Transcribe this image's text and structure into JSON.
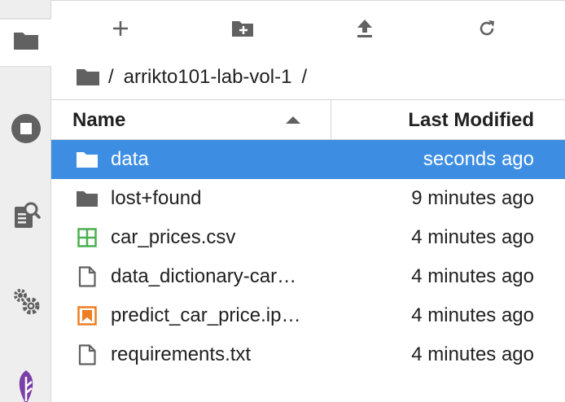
{
  "activity_bar": {
    "items": [
      {
        "name": "file-browser",
        "icon": "folder-icon",
        "active": true
      },
      {
        "name": "running",
        "icon": "stop-circle-icon",
        "active": false
      },
      {
        "name": "property-inspector",
        "icon": "inspector-icon",
        "active": false
      },
      {
        "name": "extensions",
        "icon": "gears-icon",
        "active": false
      },
      {
        "name": "kale",
        "icon": "kale-logo-icon",
        "active": false
      }
    ]
  },
  "toolbar": {
    "buttons": [
      {
        "name": "new-launcher",
        "icon": "plus-icon"
      },
      {
        "name": "new-folder",
        "icon": "new-folder-icon"
      },
      {
        "name": "upload",
        "icon": "upload-icon"
      },
      {
        "name": "refresh",
        "icon": "refresh-icon"
      }
    ]
  },
  "breadcrumb": {
    "root": "/",
    "folder": "arrikto101-lab-vol-1",
    "trailing": "/"
  },
  "listing": {
    "header_name": "Name",
    "header_modified": "Last Modified",
    "files": [
      {
        "name": "data",
        "modified": "seconds ago",
        "type": "folder",
        "selected": true
      },
      {
        "name": "lost+found",
        "modified": "9 minutes ago",
        "type": "folder",
        "selected": false
      },
      {
        "name": "car_prices.csv",
        "modified": "4 minutes ago",
        "type": "csv",
        "selected": false
      },
      {
        "name": "data_dictionary-car…",
        "modified": "4 minutes ago",
        "type": "file",
        "selected": false
      },
      {
        "name": "predict_car_price.ip…",
        "modified": "4 minutes ago",
        "type": "notebook",
        "selected": false
      },
      {
        "name": "requirements.txt",
        "modified": "4 minutes ago",
        "type": "file",
        "selected": false
      }
    ]
  },
  "colors": {
    "selection": "#3d8ee3",
    "icon_gray": "#616161",
    "csv_green": "#4caf50",
    "notebook_orange": "#ef7d22",
    "kale_purple": "#7b3fa8"
  }
}
